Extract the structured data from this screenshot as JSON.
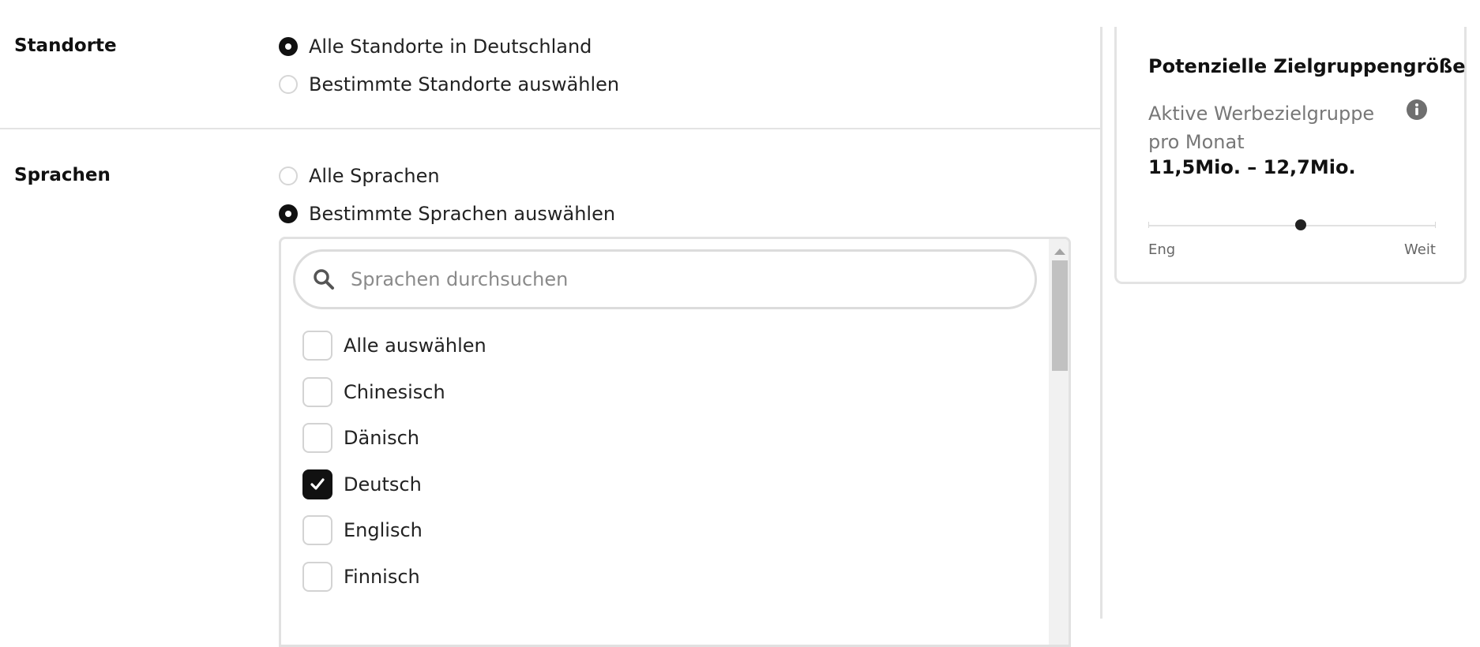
{
  "locations": {
    "label": "Standorte",
    "options": [
      {
        "label": "Alle Standorte in Deutschland",
        "selected": true
      },
      {
        "label": "Bestimmte Standorte auswählen",
        "selected": false
      }
    ]
  },
  "languages": {
    "label": "Sprachen",
    "options": [
      {
        "label": "Alle Sprachen",
        "selected": false
      },
      {
        "label": "Bestimmte Sprachen auswählen",
        "selected": true
      }
    ],
    "search_placeholder": "Sprachen durchsuchen",
    "items": [
      {
        "label": "Alle auswählen",
        "checked": false
      },
      {
        "label": "Chinesisch",
        "checked": false
      },
      {
        "label": "Dänisch",
        "checked": false
      },
      {
        "label": "Deutsch",
        "checked": true
      },
      {
        "label": "Englisch",
        "checked": false
      },
      {
        "label": "Finnisch",
        "checked": false
      }
    ]
  },
  "audience": {
    "title": "Potenzielle Zielgruppengröße",
    "subtitle": "Aktive Werbezielgruppe pro Monat",
    "range": "11,5Mio. – 12,7Mio.",
    "slider_min_label": "Eng",
    "slider_max_label": "Weit",
    "slider_value_fraction": 0.53,
    "info_icon": "info-icon"
  },
  "colors": {
    "selected": "#111111",
    "border": "#e3e3e3",
    "muted_text": "#777777"
  }
}
